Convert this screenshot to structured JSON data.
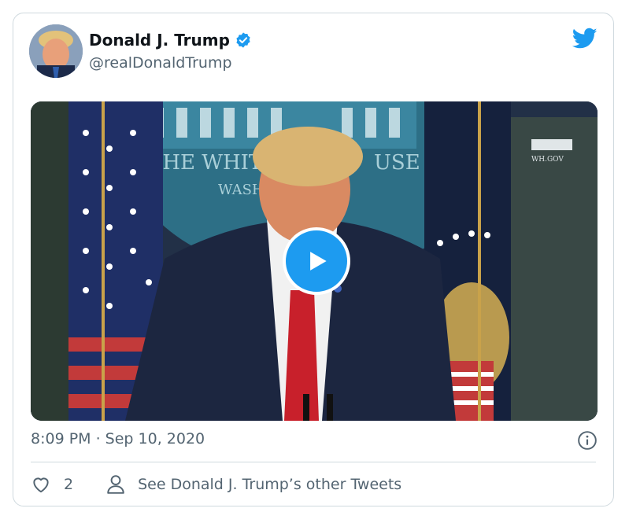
{
  "tweet": {
    "author_name": "Donald J. Trump",
    "handle": "@realDonaldTrump",
    "timestamp": "8:09 PM · Sep 10, 2020",
    "like_count": "2",
    "other_tweets_label": "See Donald J. Trump’s other Tweets"
  },
  "media": {
    "backdrop_line1": "THE WHIT",
    "backdrop_line1b": "USE",
    "backdrop_line2": "WASH",
    "screen_label": "WH.GOV"
  },
  "icons": {
    "verified": "verified-badge-icon",
    "brand": "twitter-bird-icon",
    "play": "play-icon",
    "info": "info-icon",
    "like": "heart-icon",
    "profile": "person-icon"
  },
  "colors": {
    "accent": "#1d9bf0",
    "text_primary": "#0f1419",
    "text_secondary": "#536471",
    "border": "#cfd9de",
    "tie": "#c8202b"
  }
}
